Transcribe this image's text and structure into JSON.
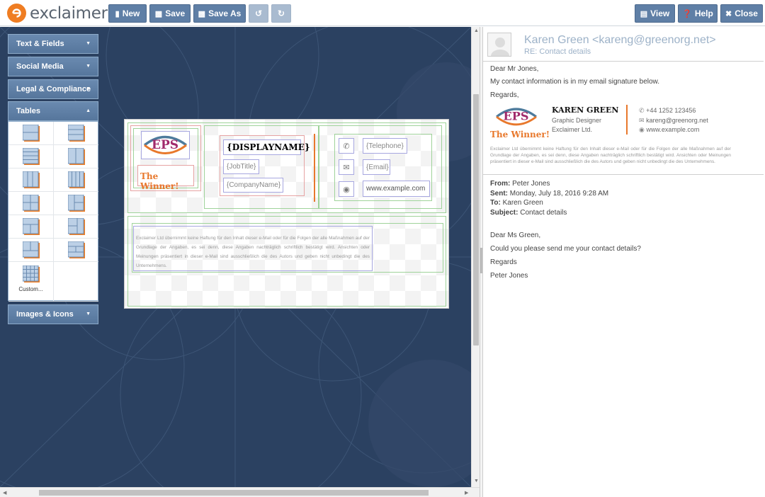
{
  "brand": {
    "name": "exclaimer"
  },
  "toolbar": {
    "new": "New",
    "save": "Save",
    "save_as": "Save As",
    "view": "View",
    "help": "Help",
    "close": "Close"
  },
  "sidebar": {
    "sections": [
      {
        "label": "Text & Fields"
      },
      {
        "label": "Social Media"
      },
      {
        "label": "Legal & Compliance"
      },
      {
        "label": "Tables"
      },
      {
        "label": "Images & Icons"
      }
    ],
    "custom_label": "Custom..."
  },
  "editor": {
    "logo_text": "EPS",
    "winner": "The Winner!",
    "displayname": "{DISPLAYNAME}",
    "jobtitle": "{JobTitle}",
    "company": "{CompanyName}",
    "telephone": "{Telephone}",
    "email": "{Email}",
    "website": "www.example.com",
    "disclaimer": "Exclaimer Ltd übernimmt keine Haftung für den Inhalt dieser e-Mail oder für die Folgen der alle Maßnahmen auf der Grundlage der Angaben, es sei denn, diese Angaben nachträglich schriftlich bestätigt wird. Ansichten oder Meinungen präsentiert in dieser e-Mail sind ausschließlich die des Autors und geben nicht unbedingt die des Unternehmens."
  },
  "preview": {
    "from_header": "Karen Green <kareng@greenorg.net>",
    "subject_header": "RE: Contact details",
    "greeting": "Dear Mr Jones,",
    "body": "My contact information is in my email signature below.",
    "regards": "Regards,",
    "sig_logo": "EPS",
    "sig_winner": "The Winner!",
    "sig_name": "KAREN GREEN",
    "sig_title": "Graphic Designer",
    "sig_company": "Exclaimer Ltd.",
    "sig_phone": "+44 1252 123456",
    "sig_email": "kareng@greenorg.net",
    "sig_web": "www.example.com",
    "sig_disclaimer": "Exclaimer Ltd übernimmt keine Haftung für den Inhalt dieser e-Mail oder für die Folgen der alle Maßnahmen auf der Grundlage der Angaben, es sei denn, diese Angaben nachträglich schriftlich bestätigt wird. Ansichten oder Meinungen präsentiert in dieser e-Mail sind ausschließlich die des Autors und geben nicht unbedingt die des Unternehmens.",
    "quoted": {
      "from_label": "From:",
      "from": "Peter Jones",
      "sent_label": "Sent:",
      "sent": "Monday, July 18, 2016 9:28 AM",
      "to_label": "To:",
      "to": "Karen Green",
      "subject_label": "Subject:",
      "subject": "Contact details",
      "greeting": "Dear Ms Green,",
      "body": "Could you please send me your contact details?",
      "regards": "Regards",
      "signoff": "Peter Jones"
    }
  },
  "colors": {
    "toolbar_button": "#5f7fa6",
    "canvas": "#2b4161",
    "accent": "#ef7d22",
    "link": "#9db2c8"
  }
}
